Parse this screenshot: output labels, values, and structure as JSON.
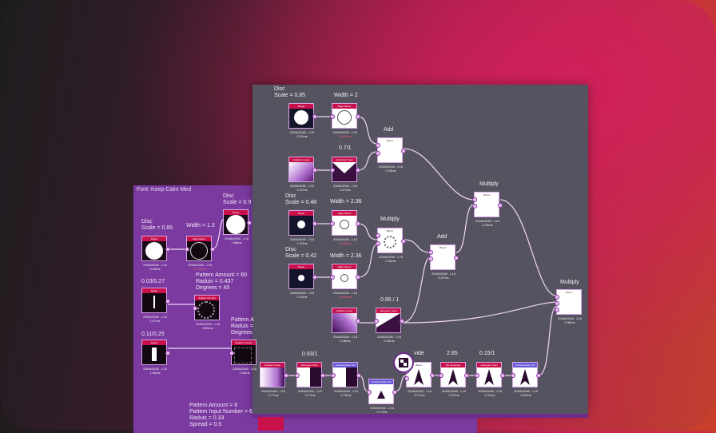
{
  "purple_panel": {
    "title": "Font: Keep Calm Med",
    "labels": {
      "disc_a": "Disc\nScale = 0.85",
      "width_a": "Width = 1.3",
      "disc_b": "Disc\nScale = 0.9",
      "ratio_a": "0.03/0.27",
      "pattern_a": "Pattern Amount = 60\nRaduis = 0.437\nDegrees = 45",
      "pattern_b": "Pattern A\nRaduis =\nDegrees",
      "ratio_b": "0.11/0.25",
      "pattern_c": "Pattern Amount = 6\nPattern Input Number = 6\nRaduis = 0.33\nSpread = 0.5"
    },
    "nodes": [
      {
        "name": "Shape",
        "res": "2048x2048 - L16",
        "time": "0.94ms"
      },
      {
        "name": "Edge Detect",
        "res": "2048x2048 - L16",
        "time": "17.06ms"
      },
      {
        "name": "Shape",
        "res": "2048x2048 - L16",
        "time": "1.86ms"
      },
      {
        "name": "Shape",
        "res": "2048x2048 - L16",
        "time": "1.07ms"
      },
      {
        "name": "Splatter Circular",
        "res": "2048x2048 - L16",
        "time": "8.65ms"
      },
      {
        "name": "Shape",
        "res": "2048x2048 - L16",
        "time": "1.60ms"
      },
      {
        "name": "Splatter Circular",
        "res": "2048x2048 - L16",
        "time": "1.18ms"
      }
    ]
  },
  "gray_panel": {
    "labels": {
      "disc_1": "Disc\nScale = 0.85",
      "width_1": "Width = 2",
      "add_1": "Add",
      "ratio_1": "0.7/1",
      "multiply_1": "Multiply",
      "disc_2": "Disc\nScale = 0.48",
      "width_2": "Width = 2.36",
      "multiply_2": "Multiply",
      "add_2": "Add",
      "disc_3": "Disc\nScale = 0.42",
      "width_3": "Width = 2.36",
      "multiply_3": "Multiply",
      "ratio_2": "0.95 / 1",
      "ratio_3": "0.93/1",
      "divide": "vide",
      "val_285": "2.85",
      "ratio_4": "0.15/1"
    },
    "nodes": [
      {
        "name": "Shape",
        "res": "2048x2048 - L16",
        "time": "0.91ms"
      },
      {
        "name": "Edge Detect",
        "res": "2048x2048 - L16",
        "time": "18.79ms"
      },
      {
        "name": "Blend",
        "res": "2048x2048 - L16",
        "time": "0.25ms"
      },
      {
        "name": "Gradient Linear",
        "res": "2048x2048 - L16",
        "time": "1.37ms"
      },
      {
        "name": "Histogram Scan",
        "res": "2048x2048 - L16",
        "time": "0.27ms"
      },
      {
        "name": "Blend",
        "res": "2048x2048 - L16",
        "time": "0.29ms"
      },
      {
        "name": "Shape",
        "res": "2048x2048 - L16",
        "time": "1.37ms"
      },
      {
        "name": "Edge Detect",
        "res": "2048x2048 - L16",
        "time": "18.65ms"
      },
      {
        "name": "Blend",
        "res": "2048x2048 - L16",
        "time": "0.33ms"
      },
      {
        "name": "Blend",
        "res": "2048x2048 - L16",
        "time": "0.27ms"
      },
      {
        "name": "Shape",
        "res": "2048x2048 - L16",
        "time": "0.91ms"
      },
      {
        "name": "Edge Detect",
        "res": "2048x2048 - L16",
        "time": "18.65ms"
      },
      {
        "name": "Gradient Linear",
        "res": "2048x2048 - L16",
        "time": "0.48ms"
      },
      {
        "name": "Histogram Scan",
        "res": "2048x2048 - L16",
        "time": "0.26ms"
      },
      {
        "name": "Blend",
        "res": "2048x2048 - L16",
        "time": "0.36ms"
      },
      {
        "name": "Gradient Linear",
        "res": "2048x2048 - L16",
        "time": "0.77ms"
      },
      {
        "name": "Histogram Scan",
        "res": "2048x2048 - L16",
        "time": "0.77ms"
      },
      {
        "name": "Transformation 2D",
        "res": "2048x2048 - L16",
        "time": "0.76ms"
      },
      {
        "name": "Transformation 2D",
        "res": "2048x2048 - L16",
        "time": "0.77ms"
      },
      {
        "name": "Blend",
        "res": "2048x2048 - L16",
        "time": "0.77ms"
      },
      {
        "name": "Tile Generator",
        "res": "2048x2048 - L16",
        "time": "7.97ms"
      },
      {
        "name": "Histogram Scan",
        "res": "2048x2048 - L16",
        "time": "0.11ms"
      },
      {
        "name": "Transformation 2D",
        "res": "2048x2048 - L16",
        "time": "0.32ms"
      }
    ]
  }
}
